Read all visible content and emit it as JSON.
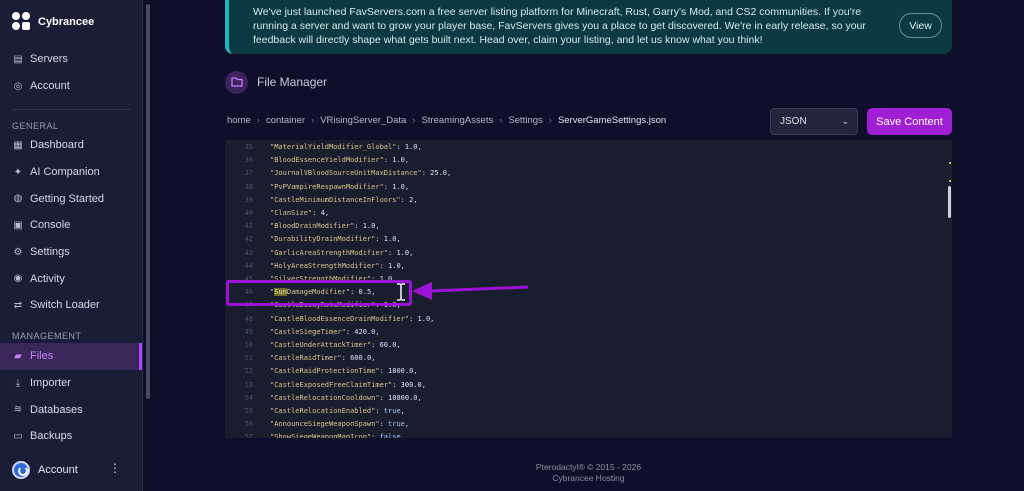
{
  "brand": {
    "name": "Cybrancee"
  },
  "sidebar": {
    "top_items": [
      {
        "label": "Servers",
        "icon": "server-icon"
      },
      {
        "label": "Account",
        "icon": "account-icon"
      }
    ],
    "general_label": "GENERAL",
    "general_items": [
      {
        "label": "Dashboard",
        "icon": "dashboard-icon"
      },
      {
        "label": "AI Companion",
        "icon": "ai-icon"
      },
      {
        "label": "Getting Started",
        "icon": "globe-icon"
      },
      {
        "label": "Console",
        "icon": "console-icon"
      },
      {
        "label": "Settings",
        "icon": "gear-icon"
      },
      {
        "label": "Activity",
        "icon": "eye-icon"
      },
      {
        "label": "Switch Loader",
        "icon": "swap-icon"
      }
    ],
    "management_label": "MANAGEMENT",
    "management_items": [
      {
        "label": "Files",
        "icon": "folder-icon",
        "active": true
      },
      {
        "label": "Importer",
        "icon": "download-icon"
      },
      {
        "label": "Databases",
        "icon": "database-icon"
      },
      {
        "label": "Backups",
        "icon": "archive-icon"
      }
    ],
    "footer_account": "Account"
  },
  "banner": {
    "text": "We've just launched FavServers.com a free server listing platform for Minecraft, Rust, Garry's Mod, and CS2 communities. If you're running a server and want to grow your player base, FavServers gives you a place to get discovered. We're in early release, so your feedback will directly shape what gets built next. Head over, claim your listing, and let us know what you think!",
    "view_label": "View"
  },
  "file_manager": {
    "title": "File Manager",
    "breadcrumb": [
      "home",
      "container",
      "VRisingServer_Data",
      "StreamingAssets",
      "Settings",
      "ServerGameSettings.json"
    ],
    "format": "JSON",
    "save_label": "Save Content"
  },
  "editor": {
    "lines": [
      {
        "n": "35",
        "key": "\"MaterialYieldModifier_Global\"",
        "val": "1.0"
      },
      {
        "n": "36",
        "key": "\"BloodEssenceYieldModifier\"",
        "val": "1.0"
      },
      {
        "n": "37",
        "key": "\"JournalVBloodSourceUnitMaxDistance\"",
        "val": "25.0"
      },
      {
        "n": "38",
        "key": "\"PvPVampireRespawnModifier\"",
        "val": "1.0"
      },
      {
        "n": "39",
        "key": "\"CastleMinimumDistanceInFloors\"",
        "val": "2"
      },
      {
        "n": "40",
        "key": "\"ClanSize\"",
        "val": "4"
      },
      {
        "n": "41",
        "key": "\"BloodDrainModifier\"",
        "val": "1.0"
      },
      {
        "n": "42",
        "key": "\"DurabilityDrainModifier\"",
        "val": "1.0"
      },
      {
        "n": "43",
        "key": "\"GarlicAreaStrengthModifier\"",
        "val": "1.0"
      },
      {
        "n": "44",
        "key": "\"HolyAreaStrengthModifier\"",
        "val": "1.0"
      },
      {
        "n": "45",
        "key": "\"SilverStrengthModifier\"",
        "val": "1.0"
      },
      {
        "n": "46",
        "key": "\"SunDamageModifier\"",
        "val": "0.5"
      },
      {
        "n": "47",
        "key": "\"CastleDecayRateModifier\"",
        "val": "1.0"
      },
      {
        "n": "48",
        "key": "\"CastleBloodEssenceDrainModifier\"",
        "val": "1.0"
      },
      {
        "n": "49",
        "key": "\"CastleSiegeTimer\"",
        "val": "420.0"
      },
      {
        "n": "50",
        "key": "\"CastleUnderAttackTimer\"",
        "val": "60.0"
      },
      {
        "n": "51",
        "key": "\"CastleRaidTimer\"",
        "val": "600.0"
      },
      {
        "n": "52",
        "key": "\"CastleRaidProtectionTime\"",
        "val": "1800.0"
      },
      {
        "n": "53",
        "key": "\"CastleExposedFreeClaimTimer\"",
        "val": "300.0"
      },
      {
        "n": "54",
        "key": "\"CastleRelocationCooldown\"",
        "val": "10800.0"
      },
      {
        "n": "55",
        "key": "\"CastleRelocationEnabled\"",
        "val": "true"
      },
      {
        "n": "56",
        "key": "\"AnnounceSiegeWeaponSpawn\"",
        "val": "true"
      },
      {
        "n": "57",
        "key": "\"ShowSiegeWeaponMapIcon\"",
        "val": "false"
      }
    ],
    "highlighted_word": "Sun"
  },
  "footer": {
    "copyright": "Pterodactyl® © 2015 - 2026",
    "host": "Cybrancee Hosting"
  }
}
